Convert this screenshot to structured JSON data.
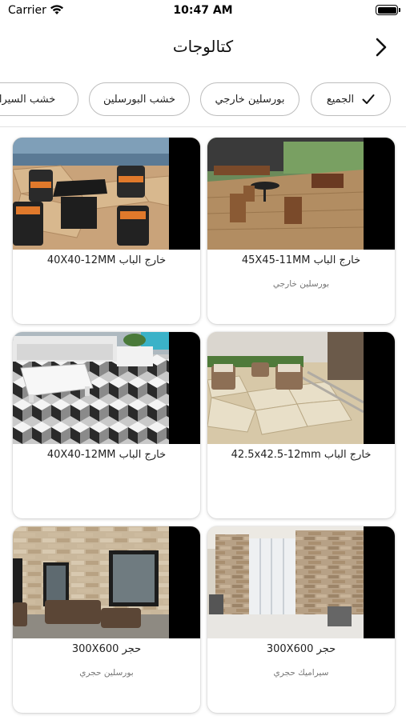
{
  "status_bar": {
    "carrier": "Carrier",
    "time": "10:47 AM"
  },
  "nav": {
    "title": "كتالوجات"
  },
  "filters": [
    {
      "label": "الجميع",
      "selected": true
    },
    {
      "label": "بورسلين خارجي",
      "selected": false
    },
    {
      "label": "خشب البورسلين",
      "selected": false
    },
    {
      "label": "خشب السيراميك",
      "selected": false
    }
  ],
  "products": [
    {
      "title": "45X45-11MM خارج الباب",
      "subtitle": "بورسلين خارجي",
      "image": "outdoor-wood-patio-photo"
    },
    {
      "title": "40X40-12MM خارج الباب",
      "subtitle": "",
      "image": "outdoor-rattan-furniture-photo"
    },
    {
      "title": "42.5x42.5-12mm خارج الباب",
      "subtitle": "",
      "image": "stone-paver-terrace-photo"
    },
    {
      "title": "40X40-12MM خارج الباب",
      "subtitle": "",
      "image": "cube-pattern-tile-photo"
    },
    {
      "title": "300X600 حجر",
      "subtitle": "سيراميك حجري",
      "image": "stone-wall-patio-photo"
    },
    {
      "title": "300X600 حجر",
      "subtitle": "بورسلين حجري",
      "image": "brick-wall-lounge-photo"
    }
  ],
  "colors": {
    "accent": "#111111",
    "chip_border": "#bdbdbd",
    "card_bg": "#ffffff"
  }
}
